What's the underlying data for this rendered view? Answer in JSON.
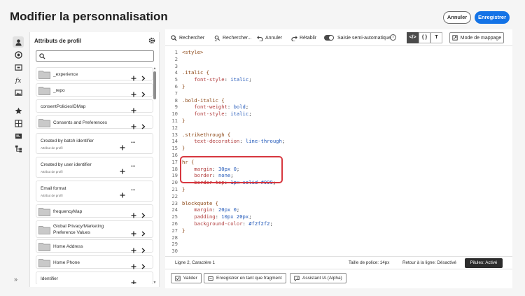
{
  "header": {
    "title": "Modifier la personnalisation",
    "cancel_label": "Annuler",
    "save_label": "Enregistrer"
  },
  "rail": {
    "icons": [
      "user-icon",
      "segment-icon",
      "rectangle-icon",
      "function-icon",
      "image-icon",
      "star-icon",
      "grid-icon",
      "card-icon",
      "hierarchy-icon"
    ],
    "expand_label": "»"
  },
  "panel": {
    "title": "Attributs de profil",
    "search_placeholder": "",
    "items": [
      {
        "label": "_experience",
        "folder": true,
        "sub": "",
        "has_dots": false,
        "has_chevron": true
      },
      {
        "label": "_repo",
        "folder": true,
        "sub": "",
        "has_dots": false,
        "has_chevron": true
      },
      {
        "label": "consentPoliciesIDMap",
        "folder": false,
        "sub": "",
        "has_dots": false,
        "has_chevron": false
      },
      {
        "label": "Consents and Preferences",
        "folder": true,
        "sub": "",
        "has_dots": false,
        "has_chevron": true
      },
      {
        "label": "Created by batch identifier",
        "folder": false,
        "sub": "Attribut de profil",
        "has_dots": true,
        "has_chevron": false
      },
      {
        "label": "Created by user identifier",
        "folder": false,
        "sub": "Attribut de profil",
        "has_dots": true,
        "has_chevron": false
      },
      {
        "label": "Email format",
        "folder": false,
        "sub": "Attribut de profil",
        "has_dots": true,
        "has_chevron": false
      },
      {
        "label": "frequencyMap",
        "folder": true,
        "sub": "",
        "has_dots": false,
        "has_chevron": true
      },
      {
        "label": "Global Privacy/Marketing Preference Values",
        "folder": true,
        "sub": "",
        "has_dots": false,
        "has_chevron": true
      },
      {
        "label": "Home Address",
        "folder": true,
        "sub": "",
        "has_dots": false,
        "has_chevron": true
      },
      {
        "label": "Home Phone",
        "folder": true,
        "sub": "",
        "has_dots": false,
        "has_chevron": true
      },
      {
        "label": "Identifier",
        "folder": false,
        "sub": "",
        "has_dots": false,
        "has_chevron": false
      }
    ]
  },
  "toolbar": {
    "search_label": "Rechercher",
    "search_replace_label": "Rechercher...",
    "undo_label": "Annuler",
    "redo_label": "Rétablir",
    "autocomplete_label": "Saisie semi-automatique",
    "autocomplete_on": true,
    "mode_html": "</>",
    "mode_json": "{ }",
    "mode_text": "T",
    "mapping_label": "Mode de mappage"
  },
  "code_lines": [
    {
      "n": "1",
      "parts": [
        {
          "t": "<style>",
          "c": "sel"
        }
      ]
    },
    {
      "n": "2",
      "parts": []
    },
    {
      "n": "3",
      "parts": []
    },
    {
      "n": "4",
      "parts": [
        {
          "t": ".italic {",
          "c": "sel"
        }
      ]
    },
    {
      "n": "5",
      "parts": [
        {
          "t": "    font-style",
          "c": "prop"
        },
        {
          "t": ": ",
          "c": "punct"
        },
        {
          "t": "italic",
          "c": "val"
        },
        {
          "t": ";",
          "c": "punct"
        }
      ]
    },
    {
      "n": "6",
      "parts": [
        {
          "t": "}",
          "c": "sel"
        }
      ]
    },
    {
      "n": "7",
      "parts": []
    },
    {
      "n": "8",
      "parts": [
        {
          "t": ".bold-italic {",
          "c": "sel"
        }
      ]
    },
    {
      "n": "9",
      "parts": [
        {
          "t": "    font-weight",
          "c": "prop"
        },
        {
          "t": ": ",
          "c": "punct"
        },
        {
          "t": "bold",
          "c": "val"
        },
        {
          "t": ";",
          "c": "punct"
        }
      ]
    },
    {
      "n": "10",
      "parts": [
        {
          "t": "    font-style",
          "c": "prop"
        },
        {
          "t": ": ",
          "c": "punct"
        },
        {
          "t": "italic",
          "c": "val"
        },
        {
          "t": ";",
          "c": "punct"
        }
      ]
    },
    {
      "n": "11",
      "parts": [
        {
          "t": "}",
          "c": "sel"
        }
      ]
    },
    {
      "n": "12",
      "parts": []
    },
    {
      "n": "13",
      "parts": [
        {
          "t": ".strikethrough {",
          "c": "sel"
        }
      ]
    },
    {
      "n": "14",
      "parts": [
        {
          "t": "    text-decoration",
          "c": "prop"
        },
        {
          "t": ": ",
          "c": "punct"
        },
        {
          "t": "line-through",
          "c": "val"
        },
        {
          "t": ";",
          "c": "punct"
        }
      ]
    },
    {
      "n": "15",
      "parts": [
        {
          "t": "}",
          "c": "sel"
        }
      ]
    },
    {
      "n": "16",
      "parts": []
    },
    {
      "n": "17",
      "parts": [
        {
          "t": "hr {",
          "c": "sel"
        }
      ]
    },
    {
      "n": "18",
      "parts": [
        {
          "t": "    margin",
          "c": "prop"
        },
        {
          "t": ": ",
          "c": "punct"
        },
        {
          "t": "30px 0",
          "c": "val"
        },
        {
          "t": ";",
          "c": "punct"
        }
      ]
    },
    {
      "n": "19",
      "parts": [
        {
          "t": "    border",
          "c": "prop"
        },
        {
          "t": ": ",
          "c": "punct"
        },
        {
          "t": "none",
          "c": "val"
        },
        {
          "t": ";",
          "c": "punct"
        }
      ]
    },
    {
      "n": "20",
      "parts": [
        {
          "t": "    border-top",
          "c": "prop"
        },
        {
          "t": ": ",
          "c": "punct"
        },
        {
          "t": "1px solid #999",
          "c": "val"
        },
        {
          "t": ";",
          "c": "punct"
        }
      ]
    },
    {
      "n": "21",
      "parts": [
        {
          "t": "}",
          "c": "sel"
        }
      ]
    },
    {
      "n": "22",
      "parts": []
    },
    {
      "n": "23",
      "parts": [
        {
          "t": "blockquote {",
          "c": "sel"
        }
      ]
    },
    {
      "n": "24",
      "parts": [
        {
          "t": "    margin",
          "c": "prop"
        },
        {
          "t": ": ",
          "c": "punct"
        },
        {
          "t": "20px 0",
          "c": "val"
        },
        {
          "t": ";",
          "c": "punct"
        }
      ]
    },
    {
      "n": "25",
      "parts": [
        {
          "t": "    padding",
          "c": "prop"
        },
        {
          "t": ": ",
          "c": "punct"
        },
        {
          "t": "10px 20px",
          "c": "val"
        },
        {
          "t": ";",
          "c": "punct"
        }
      ]
    },
    {
      "n": "26",
      "parts": [
        {
          "t": "    background-color",
          "c": "prop"
        },
        {
          "t": ": ",
          "c": "punct"
        },
        {
          "t": "#f2f2f2",
          "c": "val"
        },
        {
          "t": ";",
          "c": "punct"
        }
      ]
    },
    {
      "n": "27",
      "parts": [
        {
          "t": "}",
          "c": "sel"
        }
      ]
    },
    {
      "n": "28",
      "parts": []
    },
    {
      "n": "29",
      "parts": []
    },
    {
      "n": "30",
      "parts": []
    }
  ],
  "statusbar": {
    "position": "Ligne 2, Caractère 1",
    "font_size": "Taille de police: 14px",
    "wrap": "Retour à la ligne: Désactivé",
    "pills": "Pilules: Activé"
  },
  "actions": {
    "validate_label": "Valider",
    "save_fragment_label": "Enregistrer en tant que fragment",
    "ai_label": "Assistant IA (Alpha)"
  },
  "colors": {
    "accent": "#1473e6",
    "highlight_border": "#d7373f"
  }
}
